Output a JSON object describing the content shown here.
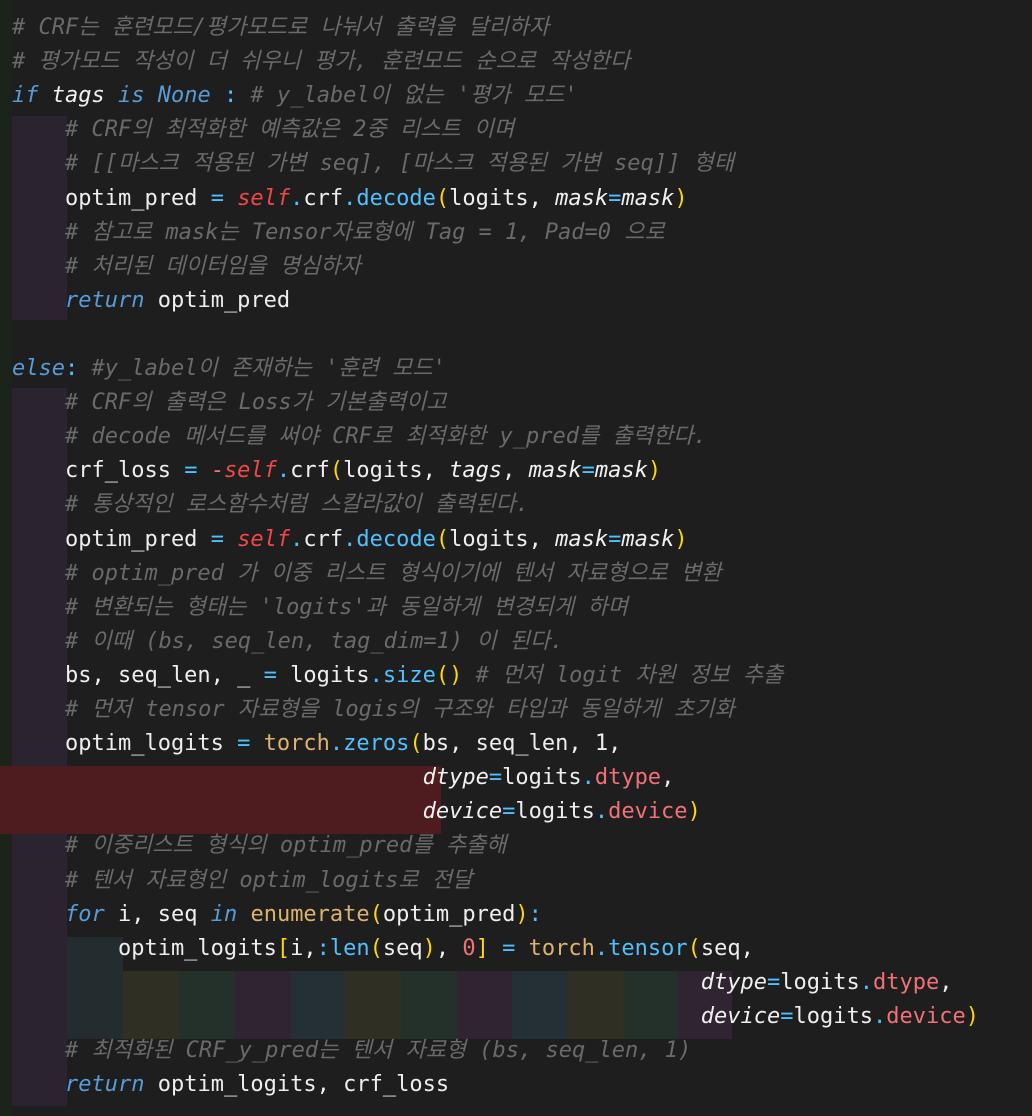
{
  "lines": [
    {
      "segments": [
        {
          "t": "# CRF는 훈련모드/평가모드로 나눠서 출력을 달리하자",
          "c": "comment"
        }
      ]
    },
    {
      "segments": [
        {
          "t": "# 평가모드 작성이 더 쉬우니 평가, 훈련모드 순으로 작성한다",
          "c": "comment"
        }
      ]
    },
    {
      "segments": [
        {
          "t": "if",
          "c": "kw"
        },
        {
          "t": " ",
          "c": "plain"
        },
        {
          "t": "tags",
          "c": "param"
        },
        {
          "t": " ",
          "c": "plain"
        },
        {
          "t": "is",
          "c": "kw"
        },
        {
          "t": " ",
          "c": "plain"
        },
        {
          "t": "None",
          "c": "kw"
        },
        {
          "t": " ",
          "c": "plain"
        },
        {
          "t": ":",
          "c": "fn"
        },
        {
          "t": " ",
          "c": "plain"
        },
        {
          "t": "# y_label이 없는 '평가 모드'",
          "c": "comment"
        }
      ]
    },
    {
      "segments": [
        {
          "t": "    # CRF의 최적화한 예측값은 2중 리스트 이며",
          "c": "comment"
        }
      ]
    },
    {
      "segments": [
        {
          "t": "    # [[마스크 적용된 가변 seq], [마스크 적용된 가변 seq]] 형태",
          "c": "comment"
        }
      ]
    },
    {
      "segments": [
        {
          "t": "    optim_pred ",
          "c": "plain"
        },
        {
          "t": "=",
          "c": "fn"
        },
        {
          "t": " ",
          "c": "plain"
        },
        {
          "t": "self",
          "c": "self"
        },
        {
          "t": ".",
          "c": "fn"
        },
        {
          "t": "crf",
          "c": "plain"
        },
        {
          "t": ".",
          "c": "fn"
        },
        {
          "t": "decode",
          "c": "fn"
        },
        {
          "t": "(",
          "c": "paren"
        },
        {
          "t": "logits",
          "c": "plain"
        },
        {
          "t": ", ",
          "c": "plain"
        },
        {
          "t": "mask",
          "c": "param"
        },
        {
          "t": "=",
          "c": "fn"
        },
        {
          "t": "mask",
          "c": "param"
        },
        {
          "t": ")",
          "c": "paren"
        }
      ]
    },
    {
      "segments": [
        {
          "t": "    # 참고로 mask는 Tensor자료형에 Tag = 1, Pad=0 으로",
          "c": "comment"
        }
      ]
    },
    {
      "segments": [
        {
          "t": "    # 처리된 데이터임을 명심하자",
          "c": "comment"
        }
      ]
    },
    {
      "segments": [
        {
          "t": "    ",
          "c": "plain"
        },
        {
          "t": "return",
          "c": "ctl"
        },
        {
          "t": " optim_pred",
          "c": "plain"
        }
      ]
    },
    {
      "segments": []
    },
    {
      "segments": [
        {
          "t": "else",
          "c": "kw"
        },
        {
          "t": ":",
          "c": "fn"
        },
        {
          "t": " ",
          "c": "plain"
        },
        {
          "t": "#y_label이 존재하는 '훈련 모드'",
          "c": "comment"
        }
      ]
    },
    {
      "segments": [
        {
          "t": "    # CRF의 출력은 Loss가 기본출력이고",
          "c": "comment"
        }
      ]
    },
    {
      "segments": [
        {
          "t": "    # decode 메서드를 써야 CRF로 최적화한 y_pred를 출력한다.",
          "c": "comment"
        }
      ]
    },
    {
      "segments": [
        {
          "t": "    crf_loss ",
          "c": "plain"
        },
        {
          "t": "=",
          "c": "fn"
        },
        {
          "t": " ",
          "c": "plain"
        },
        {
          "t": "-",
          "c": "op-red"
        },
        {
          "t": "self",
          "c": "self"
        },
        {
          "t": ".",
          "c": "fn"
        },
        {
          "t": "crf",
          "c": "plain"
        },
        {
          "t": "(",
          "c": "paren"
        },
        {
          "t": "logits",
          "c": "plain"
        },
        {
          "t": ", ",
          "c": "plain"
        },
        {
          "t": "tags",
          "c": "param"
        },
        {
          "t": ", ",
          "c": "plain"
        },
        {
          "t": "mask",
          "c": "param"
        },
        {
          "t": "=",
          "c": "fn"
        },
        {
          "t": "mask",
          "c": "param"
        },
        {
          "t": ")",
          "c": "paren"
        }
      ]
    },
    {
      "segments": [
        {
          "t": "    # 통상적인 로스함수처럼 스칼라값이 출력된다.",
          "c": "comment"
        }
      ]
    },
    {
      "segments": [
        {
          "t": "    optim_pred ",
          "c": "plain"
        },
        {
          "t": "=",
          "c": "fn"
        },
        {
          "t": " ",
          "c": "plain"
        },
        {
          "t": "self",
          "c": "self"
        },
        {
          "t": ".",
          "c": "fn"
        },
        {
          "t": "crf",
          "c": "plain"
        },
        {
          "t": ".",
          "c": "fn"
        },
        {
          "t": "decode",
          "c": "fn"
        },
        {
          "t": "(",
          "c": "paren"
        },
        {
          "t": "logits",
          "c": "plain"
        },
        {
          "t": ", ",
          "c": "plain"
        },
        {
          "t": "mask",
          "c": "param"
        },
        {
          "t": "=",
          "c": "fn"
        },
        {
          "t": "mask",
          "c": "param"
        },
        {
          "t": ")",
          "c": "paren"
        }
      ]
    },
    {
      "segments": [
        {
          "t": "    # optim_pred 가 이중 리스트 형식이기에 텐서 자료형으로 변환",
          "c": "comment"
        }
      ]
    },
    {
      "segments": [
        {
          "t": "    # 변환되는 형태는 'logits'과 동일하게 변경되게 하며",
          "c": "comment"
        }
      ]
    },
    {
      "segments": [
        {
          "t": "    # 이때 (bs, seq_len, tag_dim=1) 이 된다.",
          "c": "comment"
        }
      ]
    },
    {
      "segments": [
        {
          "t": "    bs, seq_len, _ ",
          "c": "plain"
        },
        {
          "t": "=",
          "c": "fn"
        },
        {
          "t": " logits",
          "c": "plain"
        },
        {
          "t": ".",
          "c": "fn"
        },
        {
          "t": "size",
          "c": "fn"
        },
        {
          "t": "()",
          "c": "paren"
        },
        {
          "t": " ",
          "c": "plain"
        },
        {
          "t": "# 먼저 logit 차원 정보 추출",
          "c": "comment"
        }
      ]
    },
    {
      "segments": [
        {
          "t": "    # 먼저 tensor 자료형을 logis의 구조와 타입과 동일하게 초기화",
          "c": "comment"
        }
      ]
    },
    {
      "segments": [
        {
          "t": "    optim_logits ",
          "c": "plain"
        },
        {
          "t": "=",
          "c": "fn"
        },
        {
          "t": " ",
          "c": "plain"
        },
        {
          "t": "torch",
          "c": "gold"
        },
        {
          "t": ".",
          "c": "fn"
        },
        {
          "t": "zeros",
          "c": "fn"
        },
        {
          "t": "(",
          "c": "paren"
        },
        {
          "t": "bs, seq_len, 1,",
          "c": "plain"
        }
      ]
    },
    {
      "segments": [
        {
          "t": "                               ",
          "c": "plain"
        },
        {
          "t": "dtype",
          "c": "param"
        },
        {
          "t": "=",
          "c": "fn"
        },
        {
          "t": "logits",
          "c": "plain"
        },
        {
          "t": ".",
          "c": "fn"
        },
        {
          "t": "dtype",
          "c": "attr"
        },
        {
          "t": ",",
          "c": "plain"
        }
      ]
    },
    {
      "segments": [
        {
          "t": "                               ",
          "c": "plain"
        },
        {
          "t": "device",
          "c": "param"
        },
        {
          "t": "=",
          "c": "fn"
        },
        {
          "t": "logits",
          "c": "plain"
        },
        {
          "t": ".",
          "c": "fn"
        },
        {
          "t": "device",
          "c": "attr"
        },
        {
          "t": ")",
          "c": "paren"
        }
      ]
    },
    {
      "segments": [
        {
          "t": "    # 이중리스트 형식의 optim_pred를 추출해",
          "c": "comment"
        }
      ]
    },
    {
      "segments": [
        {
          "t": "    # 텐서 자료형인 optim_logits로 전달",
          "c": "comment"
        }
      ]
    },
    {
      "segments": [
        {
          "t": "    ",
          "c": "plain"
        },
        {
          "t": "for",
          "c": "ctl"
        },
        {
          "t": " i, seq ",
          "c": "plain"
        },
        {
          "t": "in",
          "c": "ctl"
        },
        {
          "t": " ",
          "c": "plain"
        },
        {
          "t": "enumerate",
          "c": "gold"
        },
        {
          "t": "(",
          "c": "paren"
        },
        {
          "t": "optim_pred",
          "c": "plain"
        },
        {
          "t": ")",
          "c": "paren"
        },
        {
          "t": ":",
          "c": "fn"
        }
      ]
    },
    {
      "segments": [
        {
          "t": "        optim_logits",
          "c": "plain"
        },
        {
          "t": "[",
          "c": "paren"
        },
        {
          "t": "i,",
          "c": "plain"
        },
        {
          "t": ":",
          "c": "fn"
        },
        {
          "t": "len",
          "c": "fn"
        },
        {
          "t": "(",
          "c": "paren"
        },
        {
          "t": "seq",
          "c": "plain"
        },
        {
          "t": ")",
          "c": "paren"
        },
        {
          "t": ", ",
          "c": "plain"
        },
        {
          "t": "0",
          "c": "num"
        },
        {
          "t": "]",
          "c": "paren"
        },
        {
          "t": " ",
          "c": "plain"
        },
        {
          "t": "=",
          "c": "fn"
        },
        {
          "t": " ",
          "c": "plain"
        },
        {
          "t": "torch",
          "c": "gold"
        },
        {
          "t": ".",
          "c": "fn"
        },
        {
          "t": "tensor",
          "c": "fn"
        },
        {
          "t": "(",
          "c": "paren"
        },
        {
          "t": "seq,",
          "c": "plain"
        }
      ]
    },
    {
      "segments": [
        {
          "t": "                                                    ",
          "c": "plain"
        },
        {
          "t": "dtype",
          "c": "param"
        },
        {
          "t": "=",
          "c": "fn"
        },
        {
          "t": "logits",
          "c": "plain"
        },
        {
          "t": ".",
          "c": "fn"
        },
        {
          "t": "dtype",
          "c": "attr"
        },
        {
          "t": ",",
          "c": "plain"
        }
      ]
    },
    {
      "segments": [
        {
          "t": "                                                    ",
          "c": "plain"
        },
        {
          "t": "device",
          "c": "param"
        },
        {
          "t": "=",
          "c": "fn"
        },
        {
          "t": "logits",
          "c": "plain"
        },
        {
          "t": ".",
          "c": "fn"
        },
        {
          "t": "device",
          "c": "attr"
        },
        {
          "t": ")",
          "c": "paren"
        }
      ]
    },
    {
      "segments": [
        {
          "t": "    # 최적화된 CRF_y_pred는 텐서 자료형 (bs, seq_len, 1)",
          "c": "comment"
        }
      ]
    },
    {
      "segments": [
        {
          "t": "    ",
          "c": "plain"
        },
        {
          "t": "return",
          "c": "ctl"
        },
        {
          "t": " optim_logits, crf_loss",
          "c": "plain"
        }
      ]
    }
  ],
  "colors": {
    "background": "#1e1e1e",
    "indent_guide_if": "#2d2530",
    "indent_guide_else": "#2d2530",
    "error_highlight": "#5a1d1d",
    "rainbow_1": "#2f2f24",
    "rainbow_2": "#24302a",
    "rainbow_3": "#302433",
    "rainbow_4": "#243036"
  }
}
